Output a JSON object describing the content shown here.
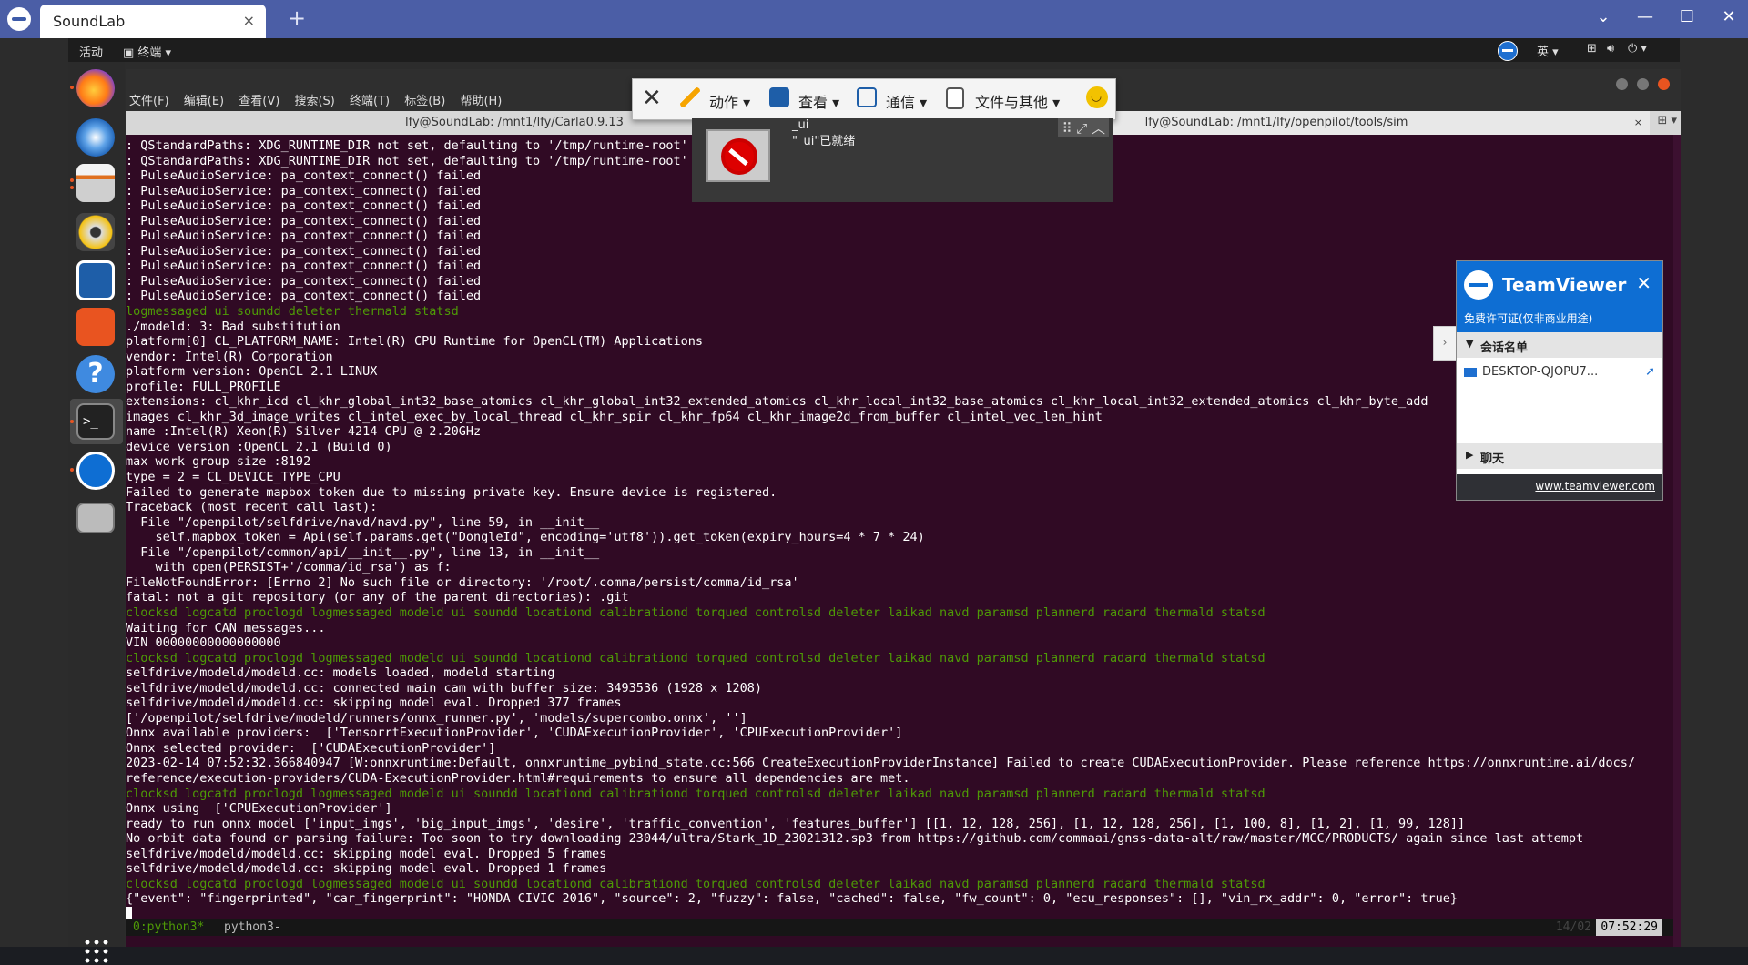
{
  "tv_client": {
    "tab_title": "SoundLab",
    "tab_close": "×",
    "new_tab": "+",
    "window_buttons": [
      "⌄",
      "—",
      "☐",
      "✕"
    ]
  },
  "gnome_top": {
    "activities": "活动",
    "app_menu": "终端 ▾",
    "lang": "英 ▾",
    "power": "⏻ ▾"
  },
  "tv_toolbar": {
    "close": "✕",
    "items": [
      {
        "label": "动作 ▾",
        "icon": "lightning-icon"
      },
      {
        "label": "查看 ▾",
        "icon": "monitor-icon"
      },
      {
        "label": "通信 ▾",
        "icon": "phone-icon"
      },
      {
        "label": "文件与其他 ▾",
        "icon": "file-transfer-icon"
      }
    ]
  },
  "tv_notify": {
    "line1": "_ui",
    "line2": "\"_ui\"已就绪"
  },
  "terminal": {
    "menus": [
      "文件(F)",
      "编辑(E)",
      "查看(V)",
      "搜索(S)",
      "终端(T)",
      "标签(B)",
      "帮助(H)"
    ],
    "tabs": [
      {
        "title": "lfy@SoundLab: /mnt1/lfy/Carla0.9.13",
        "close": "×"
      },
      {
        "title": "lfy@SoundLab: /mnt1/lfy/openpilot/tools/sim",
        "close": "×"
      }
    ],
    "lines": [
      {
        "t": ": QStandardPaths: XDG_RUNTIME_DIR not set, defaulting to '/tmp/runtime-root'",
        "c": "w"
      },
      {
        "t": ": QStandardPaths: XDG_RUNTIME_DIR not set, defaulting to '/tmp/runtime-root'",
        "c": "w"
      },
      {
        "t": ": PulseAudioService: pa_context_connect() failed",
        "c": "w"
      },
      {
        "t": ": PulseAudioService: pa_context_connect() failed",
        "c": "w"
      },
      {
        "t": ": PulseAudioService: pa_context_connect() failed",
        "c": "w"
      },
      {
        "t": ": PulseAudioService: pa_context_connect() failed",
        "c": "w"
      },
      {
        "t": ": PulseAudioService: pa_context_connect() failed",
        "c": "w"
      },
      {
        "t": ": PulseAudioService: pa_context_connect() failed",
        "c": "w"
      },
      {
        "t": ": PulseAudioService: pa_context_connect() failed",
        "c": "w"
      },
      {
        "t": ": PulseAudioService: pa_context_connect() failed",
        "c": "w"
      },
      {
        "t": ": PulseAudioService: pa_context_connect() failed",
        "c": "w"
      },
      {
        "t": "logmessaged ui soundd deleter thermald statsd",
        "c": "g"
      },
      {
        "t": "./modeld: 3: Bad substitution",
        "c": "w"
      },
      {
        "t": "platform[0] CL_PLATFORM_NAME: Intel(R) CPU Runtime for OpenCL(TM) Applications",
        "c": "w"
      },
      {
        "t": "vendor: Intel(R) Corporation",
        "c": "w"
      },
      {
        "t": "platform version: OpenCL 2.1 LINUX",
        "c": "w"
      },
      {
        "t": "profile: FULL_PROFILE",
        "c": "w"
      },
      {
        "t": "extensions: cl_khr_icd cl_khr_global_int32_base_atomics cl_khr_global_int32_extended_atomics cl_khr_local_int32_base_atomics cl_khr_local_int32_extended_atomics cl_khr_byte_add",
        "c": "w"
      },
      {
        "t": "images cl_khr_3d_image_writes cl_intel_exec_by_local_thread cl_khr_spir cl_khr_fp64 cl_khr_image2d_from_buffer cl_intel_vec_len_hint",
        "c": "w"
      },
      {
        "t": "name :Intel(R) Xeon(R) Silver 4214 CPU @ 2.20GHz",
        "c": "w"
      },
      {
        "t": "device version :OpenCL 2.1 (Build 0)",
        "c": "w"
      },
      {
        "t": "max work group size :8192",
        "c": "w"
      },
      {
        "t": "type = 2 = CL_DEVICE_TYPE_CPU",
        "c": "w"
      },
      {
        "t": "Failed to generate mapbox token due to missing private key. Ensure device is registered.",
        "c": "w"
      },
      {
        "t": "Traceback (most recent call last):",
        "c": "w"
      },
      {
        "t": "  File \"/openpilot/selfdrive/navd/navd.py\", line 59, in __init__",
        "c": "w"
      },
      {
        "t": "    self.mapbox_token = Api(self.params.get(\"DongleId\", encoding='utf8')).get_token(expiry_hours=4 * 7 * 24)",
        "c": "w"
      },
      {
        "t": "  File \"/openpilot/common/api/__init__.py\", line 13, in __init__",
        "c": "w"
      },
      {
        "t": "    with open(PERSIST+'/comma/id_rsa') as f:",
        "c": "w"
      },
      {
        "t": "FileNotFoundError: [Errno 2] No such file or directory: '/root/.comma/persist/comma/id_rsa'",
        "c": "w"
      },
      {
        "t": "fatal: not a git repository (or any of the parent directories): .git",
        "c": "w"
      },
      {
        "t": "clocksd logcatd proclogd logmessaged modeld ui soundd locationd calibrationd torqued controlsd deleter laikad navd paramsd plannerd radard thermald statsd",
        "c": "g"
      },
      {
        "t": "Waiting for CAN messages...",
        "c": "w"
      },
      {
        "t": "VIN 00000000000000000",
        "c": "w"
      },
      {
        "t": "clocksd logcatd proclogd logmessaged modeld ui soundd locationd calibrationd torqued controlsd deleter laikad navd paramsd plannerd radard thermald statsd",
        "c": "g"
      },
      {
        "t": "selfdrive/modeld/modeld.cc: models loaded, modeld starting",
        "c": "w"
      },
      {
        "t": "selfdrive/modeld/modeld.cc: connected main cam with buffer size: 3493536 (1928 x 1208)",
        "c": "w"
      },
      {
        "t": "selfdrive/modeld/modeld.cc: skipping model eval. Dropped 377 frames",
        "c": "w"
      },
      {
        "t": "['/openpilot/selfdrive/modeld/runners/onnx_runner.py', 'models/supercombo.onnx', '']",
        "c": "w"
      },
      {
        "t": "Onnx available providers:  ['TensorrtExecutionProvider', 'CUDAExecutionProvider', 'CPUExecutionProvider']",
        "c": "w"
      },
      {
        "t": "Onnx selected provider:  ['CUDAExecutionProvider']",
        "c": "w"
      },
      {
        "t": "2023-02-14 07:52:32.366840947 [W:onnxruntime:Default, onnxruntime_pybind_state.cc:566 CreateExecutionProviderInstance] Failed to create CUDAExecutionProvider. Please reference https://onnxruntime.ai/docs/",
        "c": "w"
      },
      {
        "t": "reference/execution-providers/CUDA-ExecutionProvider.html#requirements to ensure all dependencies are met.",
        "c": "w"
      },
      {
        "t": "clocksd logcatd proclogd logmessaged modeld ui soundd locationd calibrationd torqued controlsd deleter laikad navd paramsd plannerd radard thermald statsd",
        "c": "g"
      },
      {
        "t": "Onnx using  ['CPUExecutionProvider']",
        "c": "w"
      },
      {
        "t": "ready to run onnx model ['input_imgs', 'big_input_imgs', 'desire', 'traffic_convention', 'features_buffer'] [[1, 12, 128, 256], [1, 12, 128, 256], [1, 100, 8], [1, 2], [1, 99, 128]]",
        "c": "w"
      },
      {
        "t": "No orbit data found or parsing failure: Too soon to try downloading 23044/ultra/Stark_1D_23021312.sp3 from https://github.com/commaai/gnss-data-alt/raw/master/MCC/PRODUCTS/ again since last attempt",
        "c": "w"
      },
      {
        "t": "selfdrive/modeld/modeld.cc: skipping model eval. Dropped 5 frames",
        "c": "w"
      },
      {
        "t": "selfdrive/modeld/modeld.cc: skipping model eval. Dropped 1 frames",
        "c": "w"
      },
      {
        "t": "clocksd logcatd proclogd logmessaged modeld ui soundd locationd calibrationd torqued controlsd deleter laikad navd paramsd plannerd radard thermald statsd",
        "c": "g"
      },
      {
        "t": "{\"event\": \"fingerprinted\", \"car_fingerprint\": \"HONDA CIVIC 2016\", \"source\": 2, \"fuzzy\": false, \"cached\": false, \"fw_count\": 0, \"ecu_responses\": [], \"vin_rx_addr\": 0, \"error\": true}",
        "c": "w"
      }
    ],
    "tmux": {
      "win0": "0:python3*",
      "win1": "python3-",
      "dim": "14/02",
      "clock": "07:52:29"
    }
  },
  "tv_panel": {
    "title": "TeamViewer",
    "close": "✕",
    "subtitle": "免费许可证(仅非商业用途)",
    "section_sessions": "会话名单",
    "device": "DESKTOP-QJOPU7...",
    "section_chat": "聊天",
    "link": "www.teamviewer.com",
    "handle": "›"
  }
}
